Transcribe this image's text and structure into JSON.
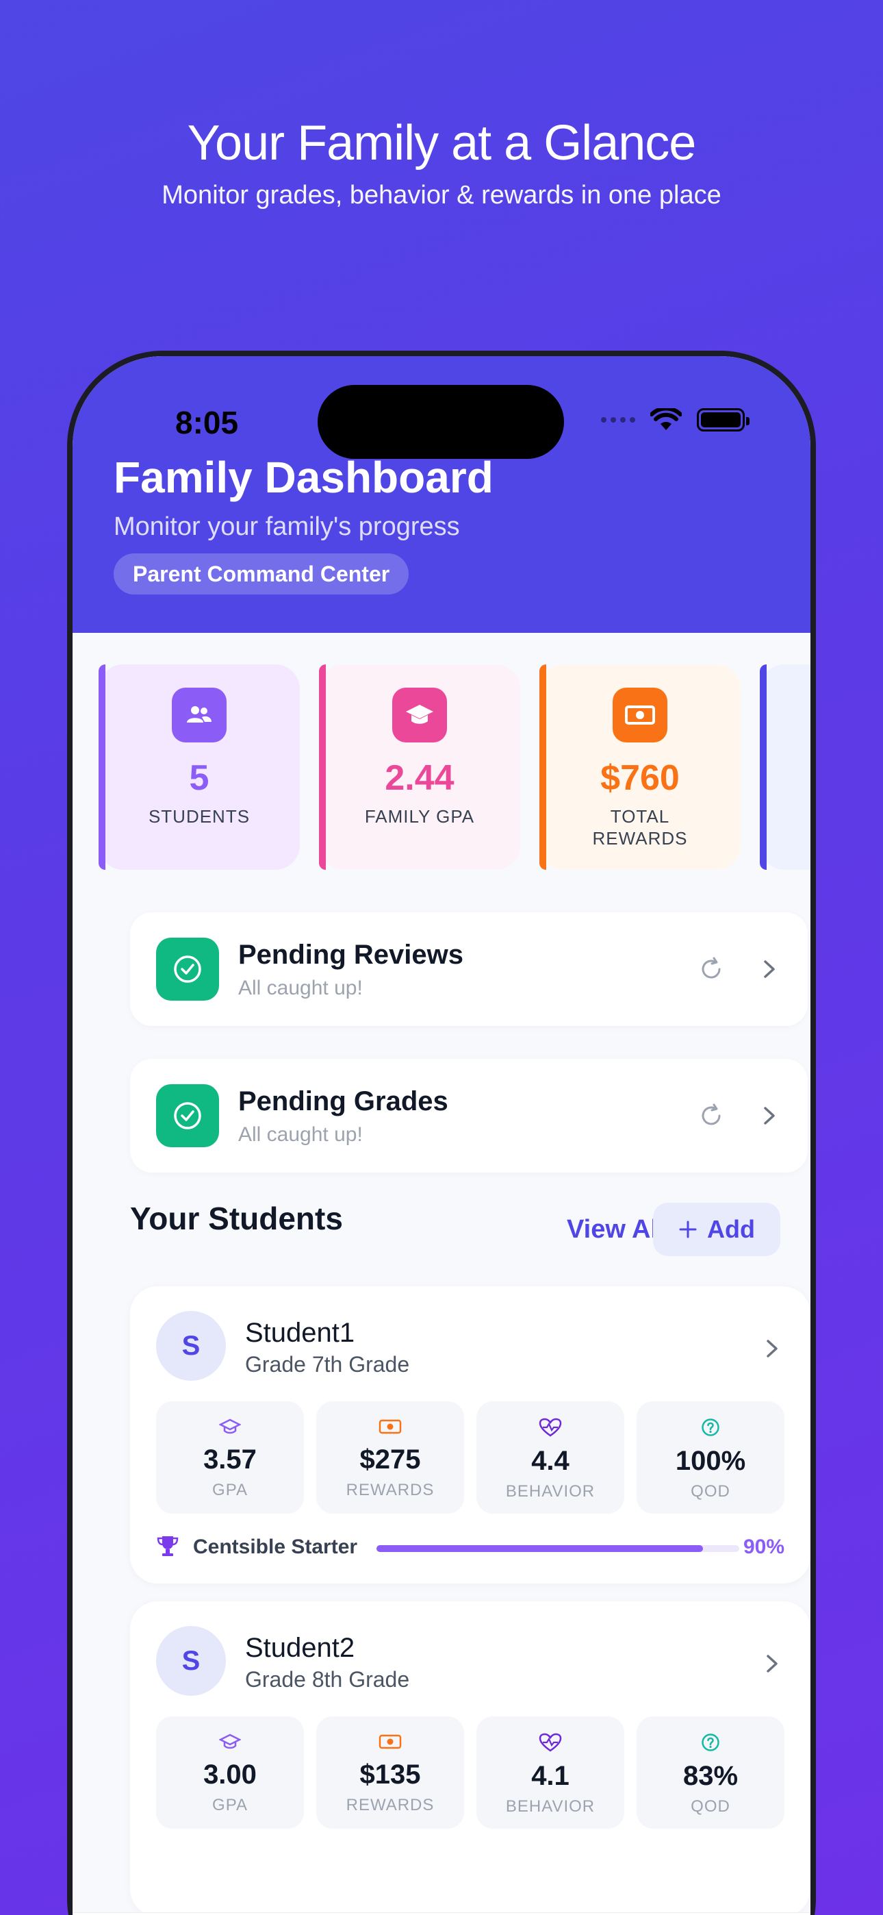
{
  "hero": {
    "title": "Your Family at a Glance",
    "subtitle": "Monitor grades, behavior & rewards in one place"
  },
  "status_bar": {
    "time": "8:05"
  },
  "header": {
    "title": "Family Dashboard",
    "subtitle": "Monitor your family's progress",
    "badge": "Parent Command Center"
  },
  "stats": [
    {
      "value": "5",
      "label": "STUDENTS",
      "icon": "people-icon",
      "color": "#8B5CF6",
      "bg": "#F3E8FF"
    },
    {
      "value": "2.44",
      "label": "FAMILY GPA",
      "icon": "graduation-cap-icon",
      "color": "#EC4899",
      "bg": "#FDF2F8"
    },
    {
      "value": "$760",
      "label_line1": "TOTAL",
      "label_line2": "REWARDS",
      "icon": "money-icon",
      "color": "#F97316",
      "bg": "#FFF7ED"
    }
  ],
  "actions": [
    {
      "title": "Pending Reviews",
      "subtitle": "All caught up!"
    },
    {
      "title": "Pending Grades",
      "subtitle": "All caught up!"
    }
  ],
  "students_section": {
    "title": "Your Students",
    "view_all": "View All",
    "add": "Add"
  },
  "students": [
    {
      "initial": "S",
      "name": "Student1",
      "grade": "Grade 7th Grade",
      "metrics": [
        {
          "value": "3.57",
          "label": "GPA"
        },
        {
          "value": "$275",
          "label": "REWARDS"
        },
        {
          "value": "4.4",
          "label": "BEHAVIOR"
        },
        {
          "value": "100%",
          "label": "QOD"
        }
      ],
      "achievement": {
        "label": "Centsible Starter",
        "progress": 0.9,
        "percent_text": "90%"
      }
    },
    {
      "initial": "S",
      "name": "Student2",
      "grade": "Grade 8th Grade",
      "metrics": [
        {
          "value": "3.00",
          "label": "GPA"
        },
        {
          "value": "$135",
          "label": "REWARDS"
        },
        {
          "value": "4.1",
          "label": "BEHAVIOR"
        },
        {
          "value": "83%",
          "label": "QOD"
        }
      ]
    }
  ],
  "tabs": [
    "home-icon",
    "graduation-cap-icon",
    "check-circle-icon",
    "lightbulb-icon",
    "wallet-icon",
    "gear-icon"
  ],
  "colors": {
    "primary": "#4F46E5",
    "success": "#10B981",
    "purple": "#8B5CF6"
  }
}
